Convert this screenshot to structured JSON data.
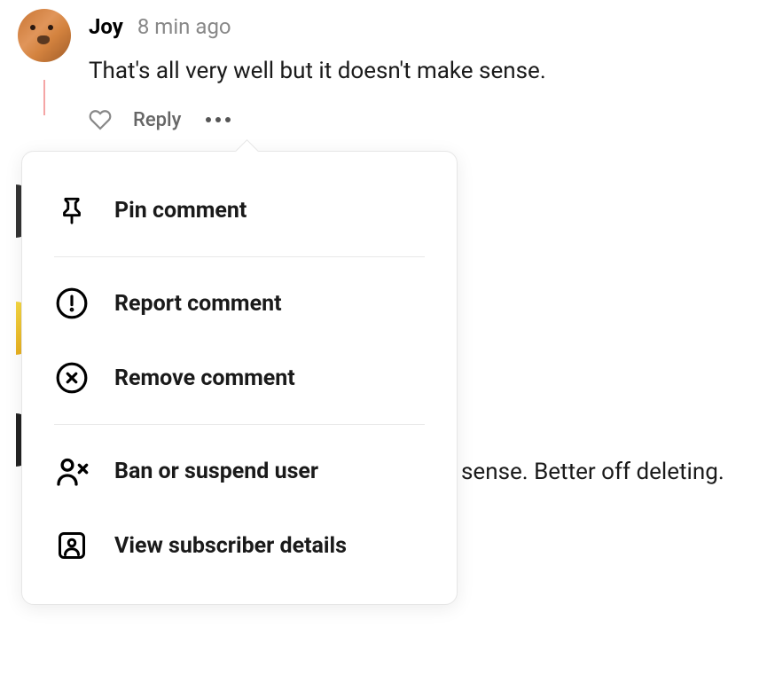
{
  "comment": {
    "author": "Joy",
    "timestamp": "8 min ago",
    "text": "That's all very well but it doesn't make sense.",
    "reply_label": "Reply"
  },
  "menu": {
    "pin": "Pin comment",
    "report": "Report comment",
    "remove": "Remove comment",
    "ban": "Ban or suspend user",
    "view_subscriber": "View subscriber details"
  },
  "background": {
    "partial_text": "sense. Better off deleting."
  }
}
